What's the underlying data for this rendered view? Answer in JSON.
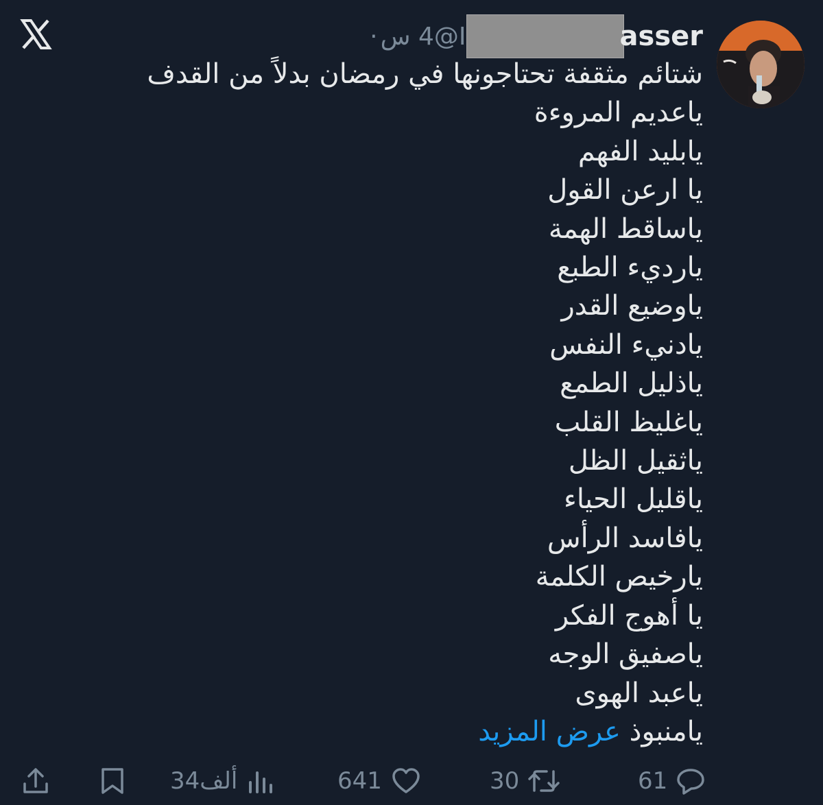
{
  "app": {
    "logo_icon": "x-logo-icon"
  },
  "tweet": {
    "author_name": "asser",
    "handle": "@I",
    "separator": "·",
    "time": "4 س",
    "avatar_icon": "profile-photo",
    "lines": [
      "شتائم مثقفة تحتاجونها في رمضان بدلاً من القدف",
      "ياعديم المروءة",
      "يابليد الفهم",
      "يا ارعن القول",
      "ياساقط الهمة",
      "يارديء الطبع",
      "ياوضيع القدر",
      "يادنيء النفس",
      "ياذليل الطمع",
      "ياغليظ القلب",
      "ياثقيل الظل",
      "ياقليل الحياء",
      "يافاسد الرأس",
      "يارخيص الكلمة",
      "يا أهوج الفكر",
      "ياصفيق الوجه",
      "ياعبد الهوى"
    ],
    "last_line_text": "يامنبوذ",
    "show_more": "عرض المزيد",
    "colors": {
      "background": "#151d2a",
      "text": "#e7e9ea",
      "muted": "#7b8a99",
      "link": "#1d9bf0"
    }
  },
  "actions": {
    "replies": "61",
    "reposts": "30",
    "likes": "641",
    "views": "34ألف",
    "icons": [
      "reply-icon",
      "repost-icon",
      "like-icon",
      "views-icon",
      "bookmark-icon",
      "share-icon"
    ]
  }
}
